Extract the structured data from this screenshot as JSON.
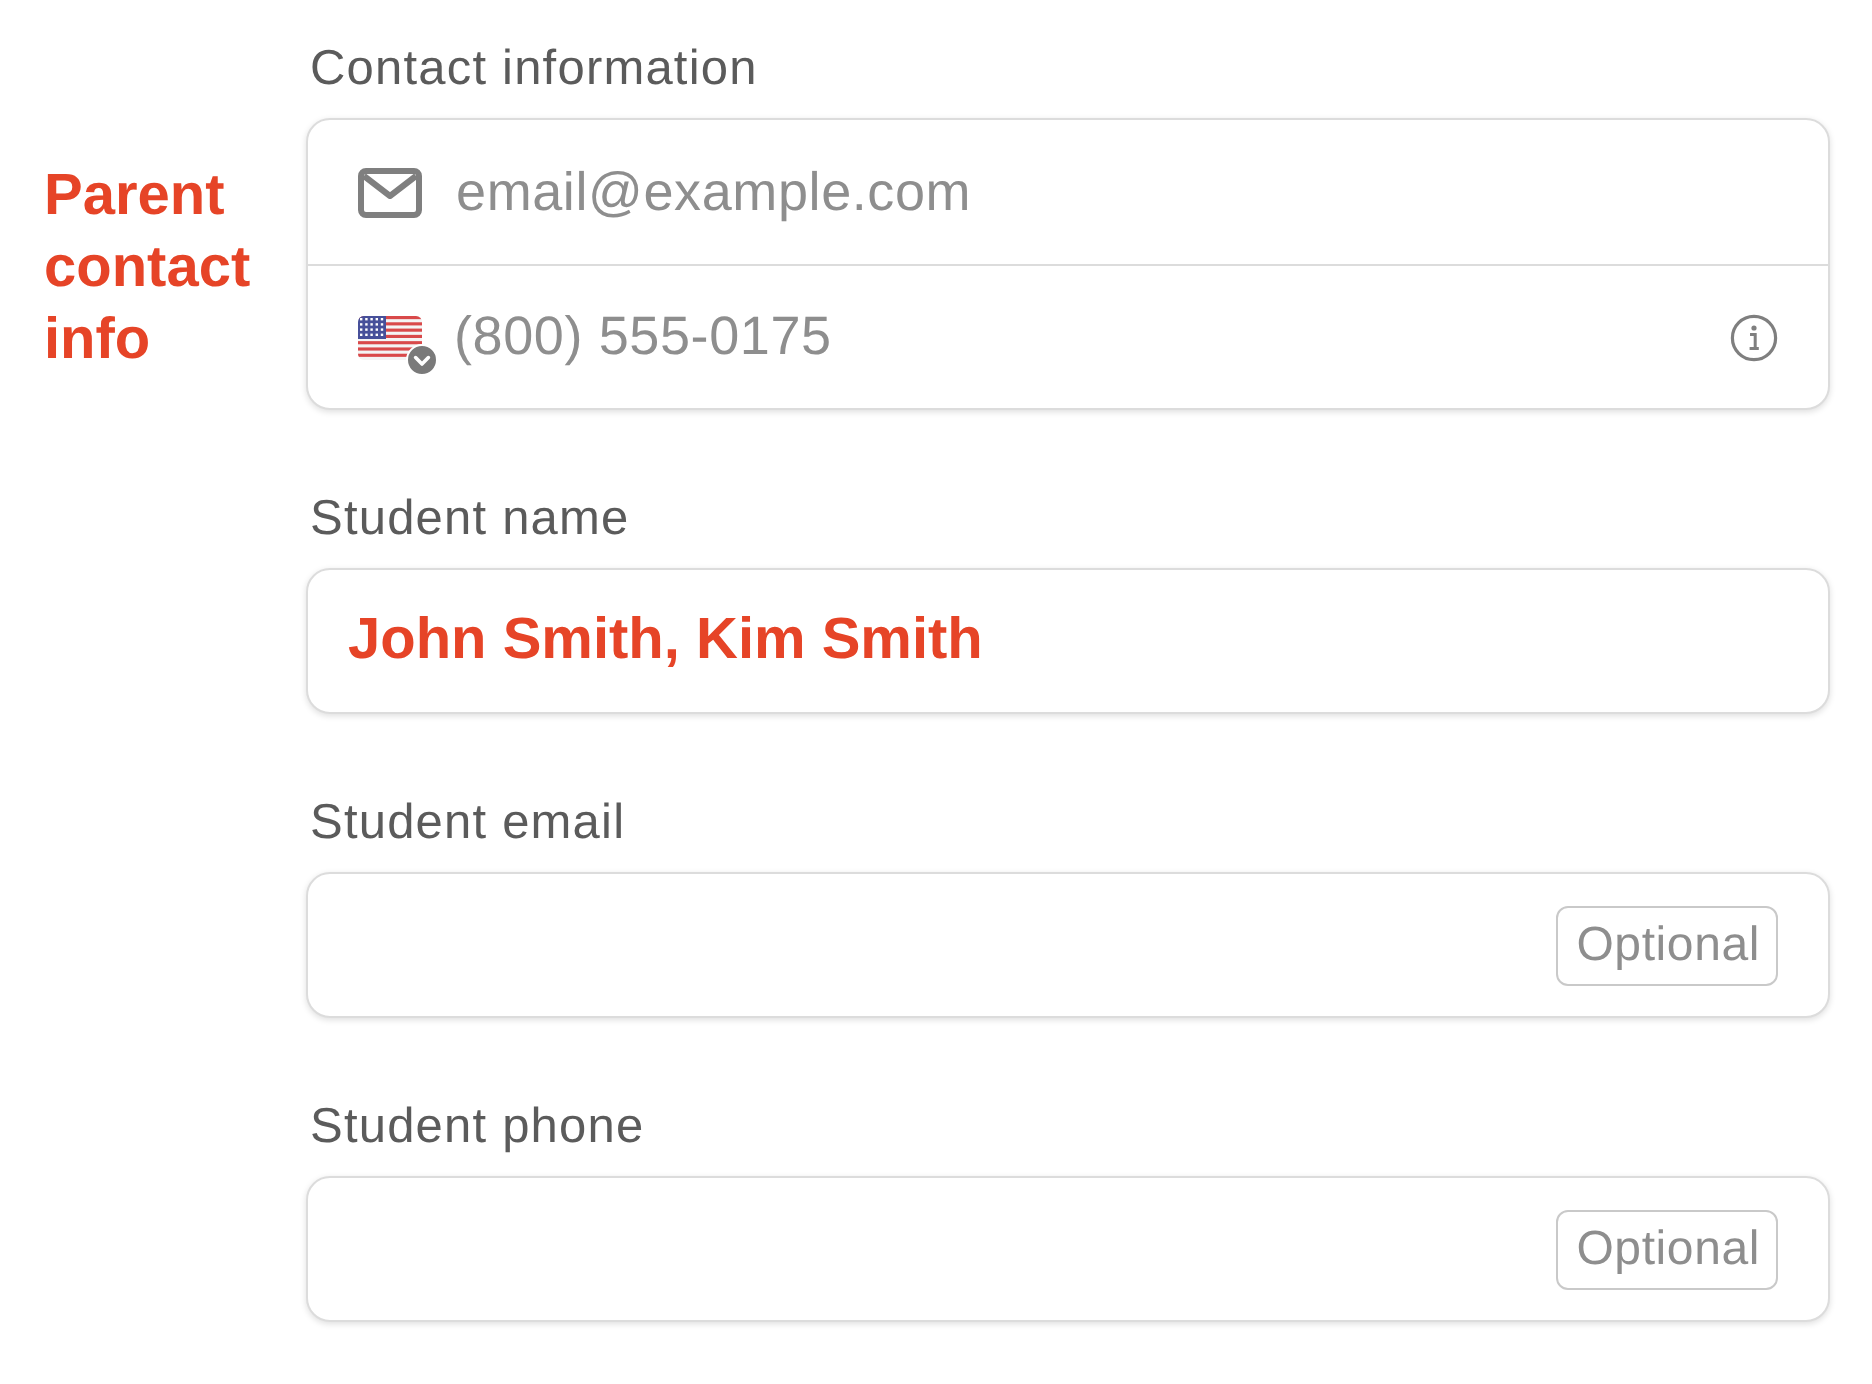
{
  "side_note": "Parent contact info",
  "sections": [
    {
      "kind": "group",
      "label": "Contact information",
      "rows": [
        {
          "kind": "email",
          "placeholder": "email@example.com"
        },
        {
          "kind": "phone",
          "placeholder": "(800) 555-0175"
        }
      ]
    },
    {
      "kind": "field",
      "label": "Student name",
      "value": "John Smith, Kim Smith"
    },
    {
      "kind": "field",
      "label": "Student email",
      "tag": "Optional"
    },
    {
      "kind": "field",
      "label": "Student phone",
      "tag": "Optional"
    }
  ]
}
